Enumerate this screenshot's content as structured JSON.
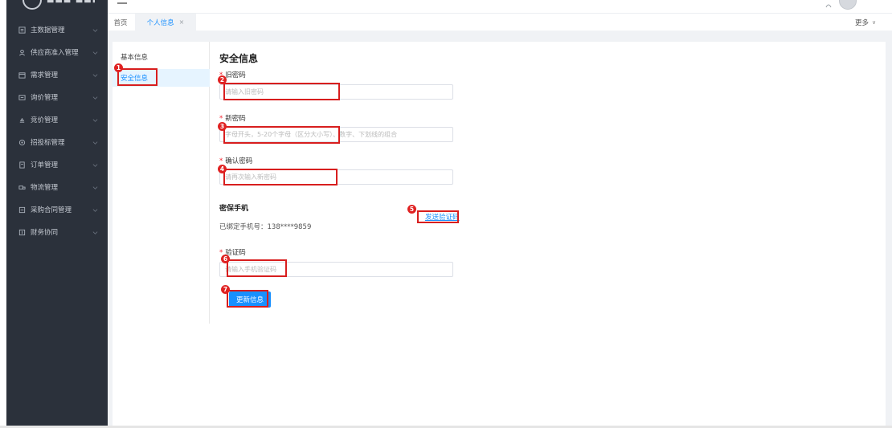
{
  "sidebar": {
    "logo_text": "■■■ ■■■",
    "menu": [
      {
        "label": "主数据管理",
        "icon": "list-icon"
      },
      {
        "label": "供应商准入管理",
        "icon": "user-icon"
      },
      {
        "label": "需求管理",
        "icon": "calendar-icon"
      },
      {
        "label": "询价管理",
        "icon": "message-icon"
      },
      {
        "label": "竞价管理",
        "icon": "gavel-icon"
      },
      {
        "label": "招投标管理",
        "icon": "target-icon"
      },
      {
        "label": "订单管理",
        "icon": "document-icon"
      },
      {
        "label": "物流管理",
        "icon": "truck-icon"
      },
      {
        "label": "采购合同管理",
        "icon": "contract-icon"
      },
      {
        "label": "财务协同",
        "icon": "finance-icon"
      }
    ]
  },
  "tabs": {
    "home": "首页",
    "active": "个人信息",
    "close": "×",
    "more": "更多",
    "more_chevron": "∨"
  },
  "left_nav": {
    "items": [
      "基本信息",
      "安全信息"
    ],
    "active_index": 1
  },
  "form": {
    "title": "安全信息",
    "required_mark": "*",
    "old_password": {
      "label": "旧密码",
      "placeholder": "请输入旧密码"
    },
    "new_password": {
      "label": "新密码",
      "placeholder": "字母开头，5-20个字母（区分大小写）、数字、下划线的组合"
    },
    "confirm_password": {
      "label": "确认密码",
      "placeholder": "请再次输入新密码"
    },
    "phone_section": {
      "title": "密保手机",
      "bound_phone": "已绑定手机号：138****9859",
      "send_code": "发送验证码"
    },
    "code": {
      "label": "验证码",
      "placeholder": "请输入手机验证码"
    },
    "submit": "更新信息"
  },
  "annotations": {
    "badges": [
      "1",
      "2",
      "3",
      "4",
      "5",
      "6",
      "7"
    ],
    "highlight_color": "#d81e1e"
  },
  "colors": {
    "sidebar_bg": "#2b313b",
    "accent": "#1890ff",
    "required": "#f5222d"
  }
}
